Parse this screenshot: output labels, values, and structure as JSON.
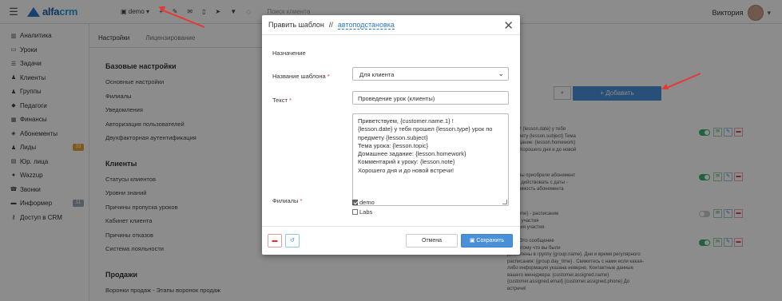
{
  "topbar": {
    "logo_brand": "alfa",
    "logo_suffix": "crm",
    "branch_label": "demo",
    "search_placeholder": "Поиск клиента",
    "user_name": "Виктория"
  },
  "sidebar": {
    "items": [
      {
        "label": "Аналитика",
        "icon": "chart-icon"
      },
      {
        "label": "Уроки",
        "icon": "calendar-icon"
      },
      {
        "label": "Задачи",
        "icon": "tasks-icon"
      },
      {
        "label": "Клиенты",
        "icon": "user-icon"
      },
      {
        "label": "Группы",
        "icon": "users-icon"
      },
      {
        "label": "Педагоги",
        "icon": "graduation-cap-icon"
      },
      {
        "label": "Финансы",
        "icon": "money-icon"
      },
      {
        "label": "Абонементы",
        "icon": "tag-icon"
      },
      {
        "label": "Лиды",
        "icon": "leads-icon",
        "badge": "33",
        "badge_color": "#e8a23a"
      },
      {
        "label": "Юр. лица",
        "icon": "building-icon"
      },
      {
        "label": "Wazzup",
        "icon": "whatsapp-icon"
      },
      {
        "label": "Звонки",
        "icon": "phone-icon"
      },
      {
        "label": "Информер",
        "icon": "inbox-icon",
        "badge": "11",
        "badge_color": "#9aa9b5"
      },
      {
        "label": "Доступ в CRM",
        "icon": "key-icon"
      }
    ]
  },
  "content": {
    "tabs": [
      "Настройки",
      "Лицензирование"
    ],
    "sections": [
      {
        "title": "Базовые настройки",
        "items": [
          "Основные настройки",
          "Филиалы",
          "Уведомления",
          "Авторизация пользователей",
          "Двухфакторная аутентификация"
        ]
      },
      {
        "title": "Клиенты",
        "items": [
          "Статусы клиентов",
          "Уровни знаний",
          "Причины пропуска уроков",
          "Кабинет клиента",
          "Причины отказов",
          "Система лояльности"
        ]
      },
      {
        "title": "Продажи",
        "items": [
          "Воронки продаж - Этапы воронок продаж"
        ]
      }
    ],
    "add_button": "+ Добавить",
    "template_rows": [
      "ме.1} ! {lesson.date} у тебя\nпредмету {lesson.subject} Тема\nее задание: {lesson.homework}\nnote} Хорошего дня и до новой",
      ", что вы приобрели абонемент\nчнает действовать с даты -\n}. Стоимость абонемента",
      "day_time} - расписание\nанята участия\nанчания участия",
      "е.1} ! Это сообщение\nски потому что вы были\nдобавлены в группу {group.name}. Дни и время регулярного\nрасписания: {group.day_time} . Свяжитесь с нами если какая-\nлибо информация указана неверно. Контактные данные\nвашего менеджера: {customer.assigned.name}\n{customer.assigned.email} {customer.assigned.phone} До\nвстречи!"
    ]
  },
  "modal": {
    "title": "Править шаблон",
    "separator": "//",
    "link": "автоподстановка",
    "fields": {
      "purpose_label": "Назначение",
      "purpose_value": "Для клиента",
      "name_label": "Название шаблона",
      "name_value": "Проведение урок (клиенты)",
      "text_label": "Текст",
      "text_lines": [
        "Приветствуем, {customer.name.1} !",
        "{lesson.date} у тебя прошел {lesson.type} урок по",
        "предмету {lesson.subject}",
        "Тема урока: {lesson.topic}",
        "Домашнее задание: {lesson.homework}",
        "Комментарий к уроку: {lesson.note}",
        "Хорошего дня и до новой встречи!"
      ],
      "branches_label": "Филиалы",
      "required_mark": "*",
      "branches": [
        {
          "label": "demo",
          "checked": true
        },
        {
          "label": "Labs",
          "checked": false
        }
      ]
    },
    "cancel_label": "Отмена",
    "save_label": "Сохранить"
  }
}
